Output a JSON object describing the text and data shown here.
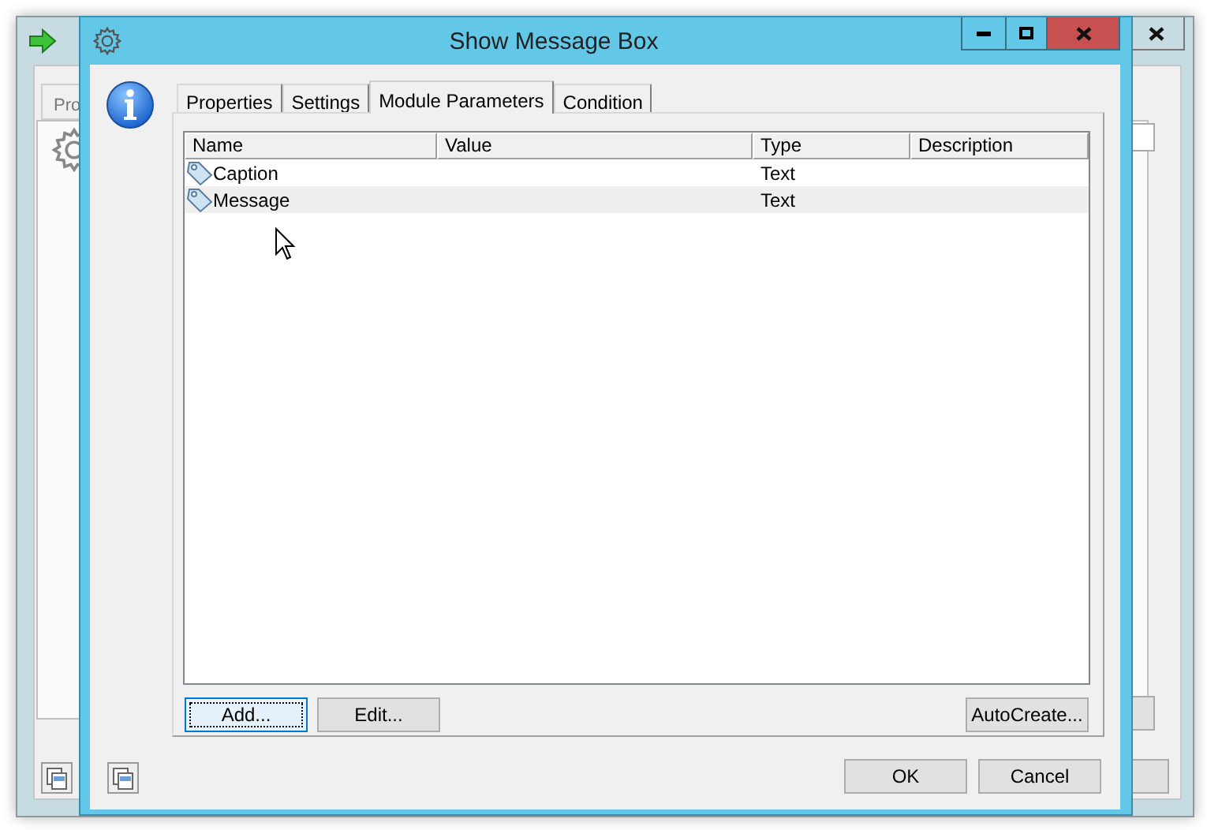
{
  "background_window": {
    "tab": "Pro"
  },
  "dialog": {
    "title": "Show Message Box"
  },
  "tabs": [
    {
      "label": "Properties",
      "selected": false
    },
    {
      "label": "Settings",
      "selected": false
    },
    {
      "label": "Module Parameters",
      "selected": true
    },
    {
      "label": "Condition",
      "selected": false
    }
  ],
  "table": {
    "columns": [
      "Name",
      "Value",
      "Type",
      "Description"
    ],
    "rows": [
      {
        "name": "Caption",
        "value": "",
        "type": "Text",
        "description": "",
        "selected": false
      },
      {
        "name": "Message",
        "value": "",
        "type": "Text",
        "description": "",
        "selected": true
      }
    ]
  },
  "list_buttons": [
    {
      "label": "Add...",
      "focused": true
    },
    {
      "label": "Edit...",
      "focused": false
    }
  ],
  "autocreate_button": "AutoCreate...",
  "dialog_buttons": [
    "OK",
    "Cancel"
  ]
}
